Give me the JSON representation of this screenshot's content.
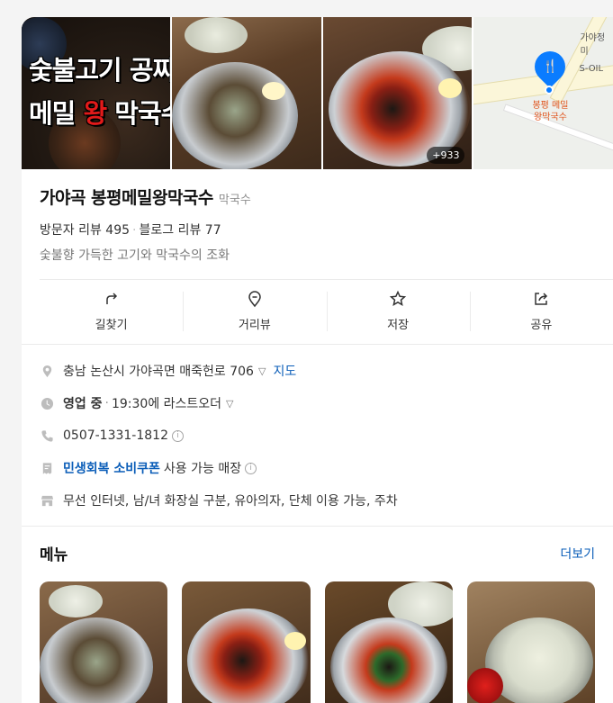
{
  "photos": {
    "promo_line1": "숯불고기 공짜",
    "promo_line2_a": "메밀",
    "promo_line2_b": "왕",
    "promo_line2_c": "막국수",
    "count": "+933"
  },
  "map": {
    "place_label_1": "봉평 메밀",
    "place_label_2": "왕막국수",
    "nearby_1": "가야정미",
    "nearby_2": "S-OIL"
  },
  "header": {
    "title": "가야곡 봉평메밀왕막국수",
    "category": "막국수",
    "visitor_reviews": "방문자 리뷰 495",
    "blog_reviews": "블로그 리뷰 77",
    "description": "숯불향 가득한 고기와 막국수의 조화"
  },
  "actions": [
    {
      "label": "길찾기",
      "icon": "directions-icon"
    },
    {
      "label": "거리뷰",
      "icon": "streetview-pin-icon"
    },
    {
      "label": "저장",
      "icon": "star-icon"
    },
    {
      "label": "공유",
      "icon": "share-icon"
    }
  ],
  "info": {
    "address": "충남 논산시 가야곡면 매죽헌로 706",
    "map_link": "지도",
    "status": "영업 중",
    "hours": "19:30에 라스트오더",
    "phone": "0507-1331-1812",
    "coupon": "민생회복 소비쿠폰",
    "coupon_suffix": "사용 가능 매장",
    "amenities": "무선 인터넷, 남/녀 화장실 구분, 유아의자, 단체 이용 가능, 주차"
  },
  "menu": {
    "title": "메뉴",
    "more": "더보기"
  }
}
